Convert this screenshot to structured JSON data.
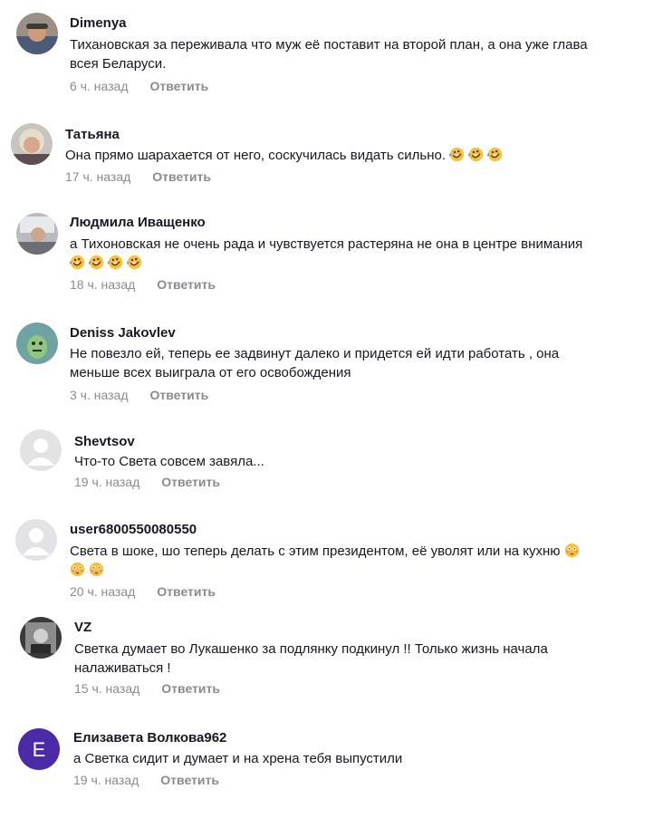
{
  "comments": [
    {
      "author": "Dimenya",
      "line1": "Тихановская за переживала что муж её поставит на второй план, а она уже глава",
      "line2": "всея Беларуси.",
      "time": "6 ч. назад",
      "reply": "Ответить"
    },
    {
      "author": "Татьяна",
      "text": "Она прямо шарахается от него, соскучилась видать сильно.",
      "emoji": "rofl-emoji",
      "time": "17 ч. назад",
      "reply": "Ответить"
    },
    {
      "author": "Людмила Иващенко",
      "text": "а Тихоновская не очень рада и чувствуется растеряна не она в центре внимания",
      "emoji": "rofl-emoji",
      "time": "18 ч. назад",
      "reply": "Ответить"
    },
    {
      "author": "Deniss Jakovlev",
      "line1": "Не повезло ей, теперь ее задвинут далеко и придется ей идти работать , она",
      "line2": "меньше всех выиграла от его освобождения",
      "time": "3 ч. назад",
      "reply": "Ответить"
    },
    {
      "author": "Shevtsov",
      "text": "Что-то Света совсем завяла...",
      "time": "19 ч. назад",
      "reply": "Ответить"
    },
    {
      "author": "user6800550080550",
      "text": "Света в шоке, шо теперь делать с этим президентом, её уволят или на кухню",
      "emoji": "flushed-emoji",
      "time": "20 ч. назад",
      "reply": "Ответить"
    },
    {
      "author": "VZ",
      "line1": "Светка думает во Лукашенко за подлянку подкинул !! Только жизнь начала",
      "line2": "налаживаться !",
      "time": "15 ч. назад",
      "reply": "Ответить"
    },
    {
      "author": "Елизавета Волкова962",
      "avatar_letter": "E",
      "text": "а Светка сидит и думает и на хрена тебя выпустили",
      "time": "19 ч. назад",
      "reply": "Ответить"
    }
  ],
  "colors": {
    "text": "#161823",
    "muted": "#8a8b91",
    "letter_avatar": "#4b2aa8"
  }
}
